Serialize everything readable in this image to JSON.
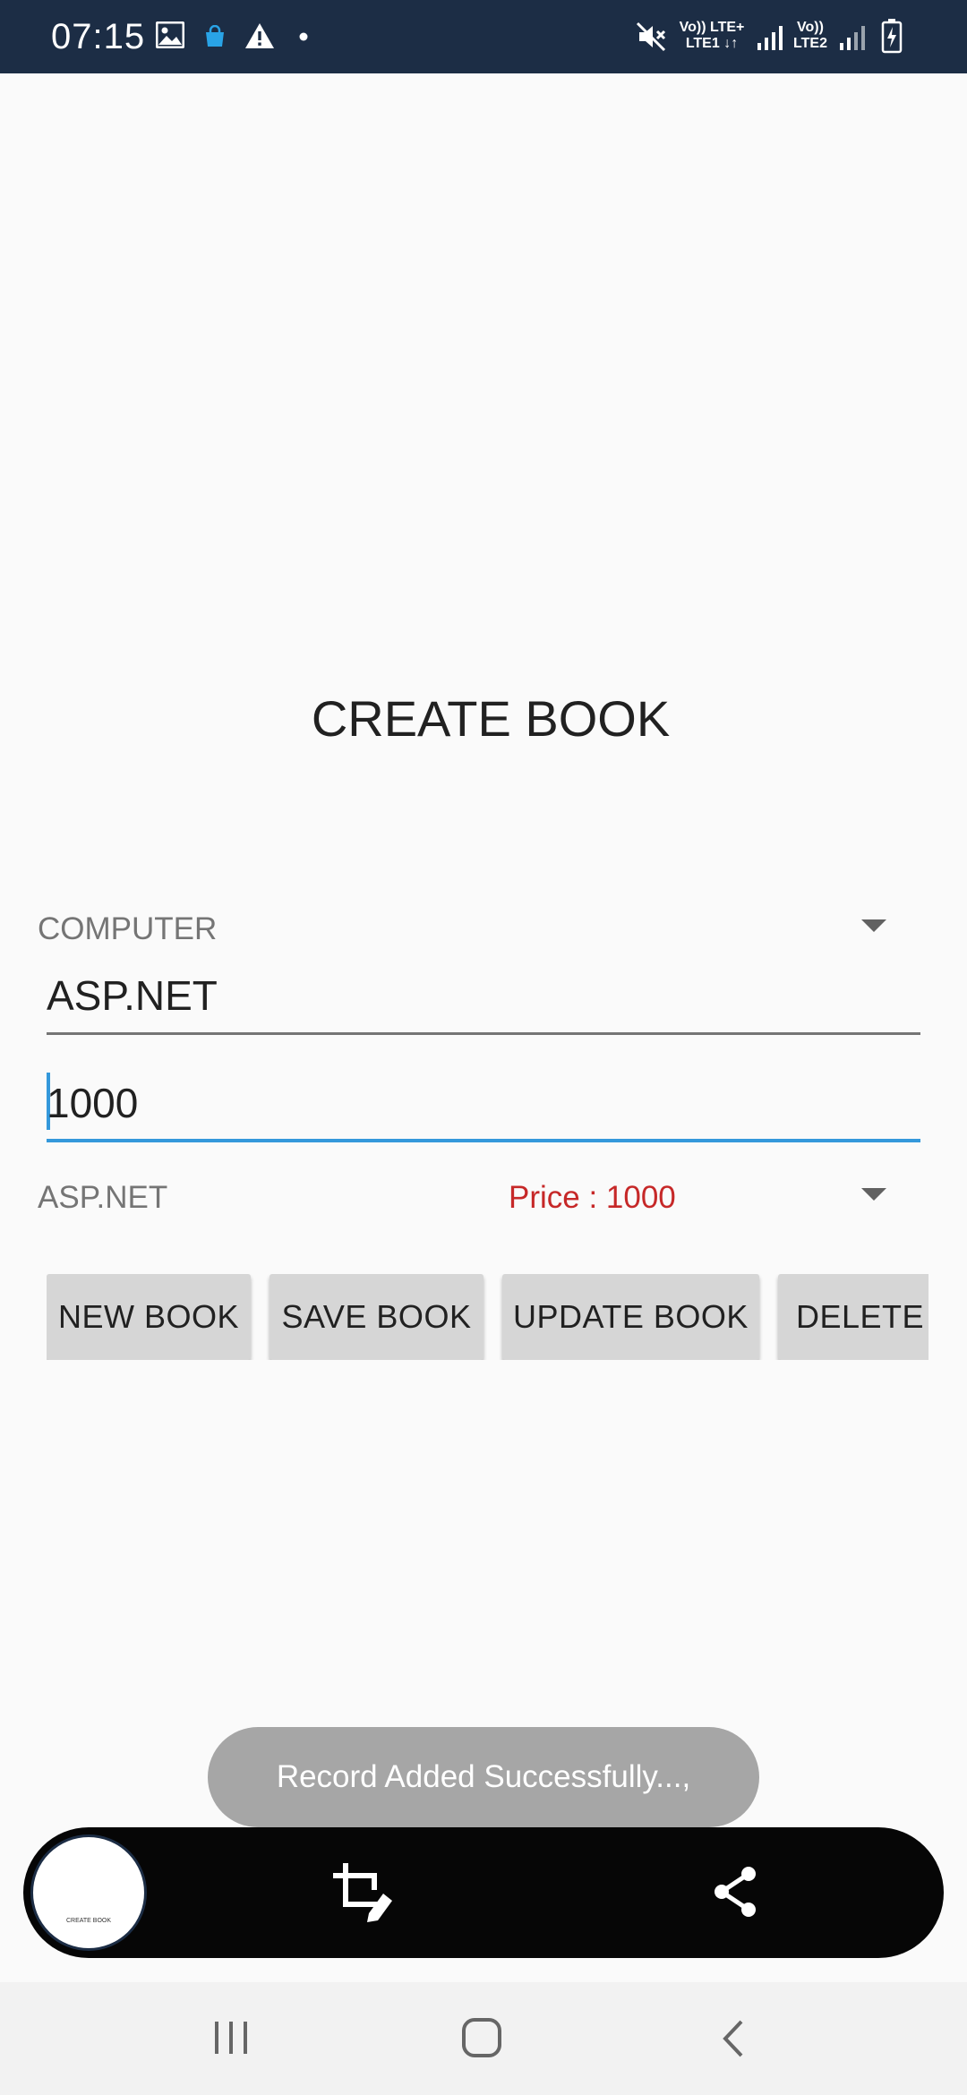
{
  "status_bar": {
    "time": "07:15",
    "icons": [
      "image-icon",
      "shopping-bag-icon",
      "warning-icon",
      "dot-icon",
      "mute-icon",
      "signal-icon",
      "signal-icon",
      "battery-charging-icon"
    ],
    "sim1": {
      "top": "Vo))  LTE+",
      "bottom": "LTE1 ↓↑"
    },
    "sim2": {
      "top": "Vo))",
      "bottom": "LTE2"
    }
  },
  "page": {
    "title": "CREATE BOOK"
  },
  "category_spinner": {
    "selected": "COMPUTER"
  },
  "book_name_field": {
    "value": "ASP.NET"
  },
  "price_field": {
    "value": "1000"
  },
  "book_spinner": {
    "selected": "ASP.NET",
    "price_label": "Price : 1000"
  },
  "buttons": {
    "new": "NEW BOOK",
    "save": "SAVE BOOK",
    "update": "UPDATE BOOK",
    "delete": "DELETE BOOK"
  },
  "toast": {
    "message": "Record Added Successfully...,"
  },
  "screenshot_toolbar": {
    "thumbnail_caption": "CREATE BOOK",
    "icons": [
      "crop-edit-icon",
      "share-icon"
    ]
  },
  "nav_bar": {
    "icons": [
      "recents-icon",
      "home-icon",
      "back-icon"
    ]
  },
  "colors": {
    "status_bar": "#1c2d45",
    "accent": "#3498db",
    "price": "#c62828",
    "button": "#d6d6d6",
    "toast": "#a6a6a6"
  }
}
